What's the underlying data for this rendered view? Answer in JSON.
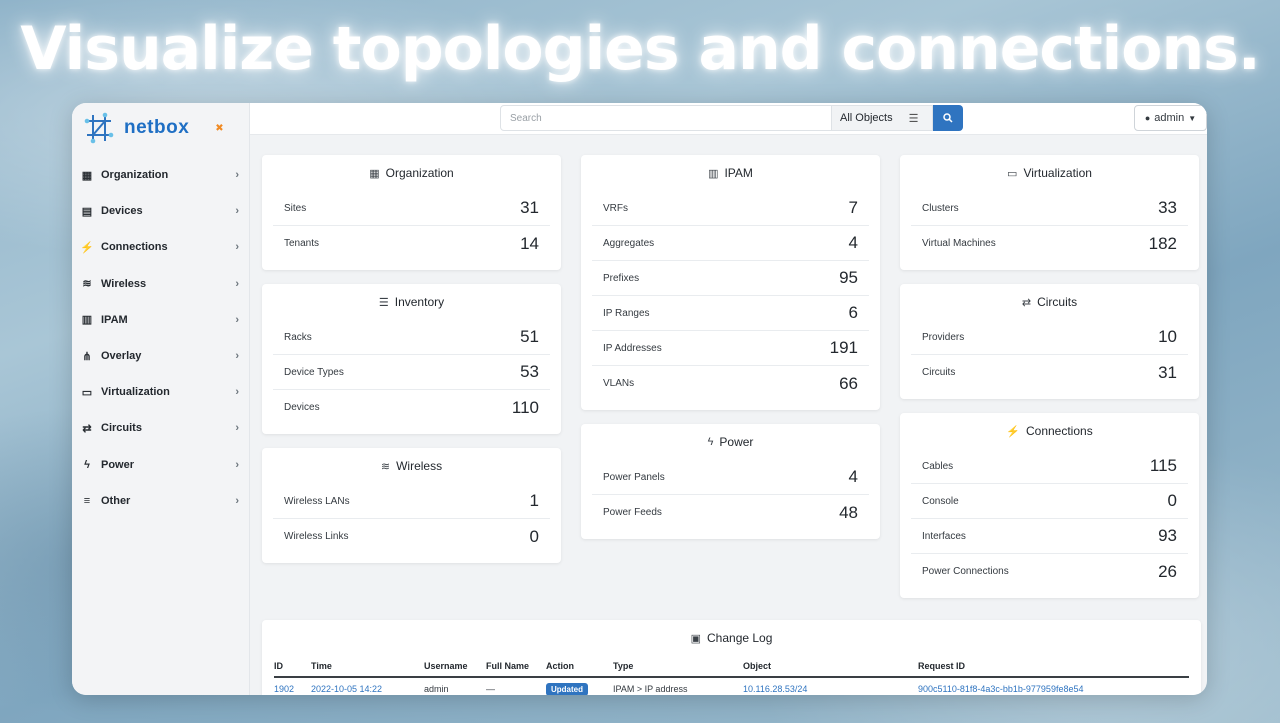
{
  "headline": "Visualize topologies and connections.",
  "brand": {
    "name": "netbox"
  },
  "sidebar": {
    "items": [
      {
        "label": "Organization",
        "icon": "building-icon"
      },
      {
        "label": "Devices",
        "icon": "server-icon"
      },
      {
        "label": "Connections",
        "icon": "plug-icon"
      },
      {
        "label": "Wireless",
        "icon": "wifi-icon"
      },
      {
        "label": "IPAM",
        "icon": "counter-icon"
      },
      {
        "label": "Overlay",
        "icon": "share-icon"
      },
      {
        "label": "Virtualization",
        "icon": "monitor-icon"
      },
      {
        "label": "Circuits",
        "icon": "transit-icon"
      },
      {
        "label": "Power",
        "icon": "bolt-icon"
      },
      {
        "label": "Other",
        "icon": "lines-icon"
      }
    ]
  },
  "topbar": {
    "search_placeholder": "Search",
    "search_scope": "All Objects",
    "user": "admin"
  },
  "cards": {
    "organization": {
      "title": "Organization",
      "rows": [
        {
          "label": "Sites",
          "count": "31"
        },
        {
          "label": "Tenants",
          "count": "14"
        }
      ]
    },
    "inventory": {
      "title": "Inventory",
      "rows": [
        {
          "label": "Racks",
          "count": "51"
        },
        {
          "label": "Device Types",
          "count": "53"
        },
        {
          "label": "Devices",
          "count": "110"
        }
      ]
    },
    "wireless": {
      "title": "Wireless",
      "rows": [
        {
          "label": "Wireless LANs",
          "count": "1"
        },
        {
          "label": "Wireless Links",
          "count": "0"
        }
      ]
    },
    "ipam": {
      "title": "IPAM",
      "rows": [
        {
          "label": "VRFs",
          "count": "7"
        },
        {
          "label": "Aggregates",
          "count": "4"
        },
        {
          "label": "Prefixes",
          "count": "95"
        },
        {
          "label": "IP Ranges",
          "count": "6"
        },
        {
          "label": "IP Addresses",
          "count": "191"
        },
        {
          "label": "VLANs",
          "count": "66"
        }
      ]
    },
    "power": {
      "title": "Power",
      "rows": [
        {
          "label": "Power Panels",
          "count": "4"
        },
        {
          "label": "Power Feeds",
          "count": "48"
        }
      ]
    },
    "virtualization": {
      "title": "Virtualization",
      "rows": [
        {
          "label": "Clusters",
          "count": "33"
        },
        {
          "label": "Virtual Machines",
          "count": "182"
        }
      ]
    },
    "circuits": {
      "title": "Circuits",
      "rows": [
        {
          "label": "Providers",
          "count": "10"
        },
        {
          "label": "Circuits",
          "count": "31"
        }
      ]
    },
    "connections": {
      "title": "Connections",
      "rows": [
        {
          "label": "Cables",
          "count": "115"
        },
        {
          "label": "Console",
          "count": "0"
        },
        {
          "label": "Interfaces",
          "count": "93"
        },
        {
          "label": "Power Connections",
          "count": "26"
        }
      ]
    }
  },
  "changelog": {
    "title": "Change Log",
    "headers": [
      "ID",
      "Time",
      "Username",
      "Full Name",
      "Action",
      "Type",
      "Object",
      "Request ID"
    ],
    "rows": [
      {
        "id": "1902",
        "time": "2022-10-05 14:22",
        "username": "admin",
        "full_name": "—",
        "action": "Updated",
        "type": "IPAM > IP address",
        "object": "10.116.28.53/24",
        "request_id": "900c5110-81f8-4a3c-bb1b-977959fe8e54"
      }
    ]
  }
}
